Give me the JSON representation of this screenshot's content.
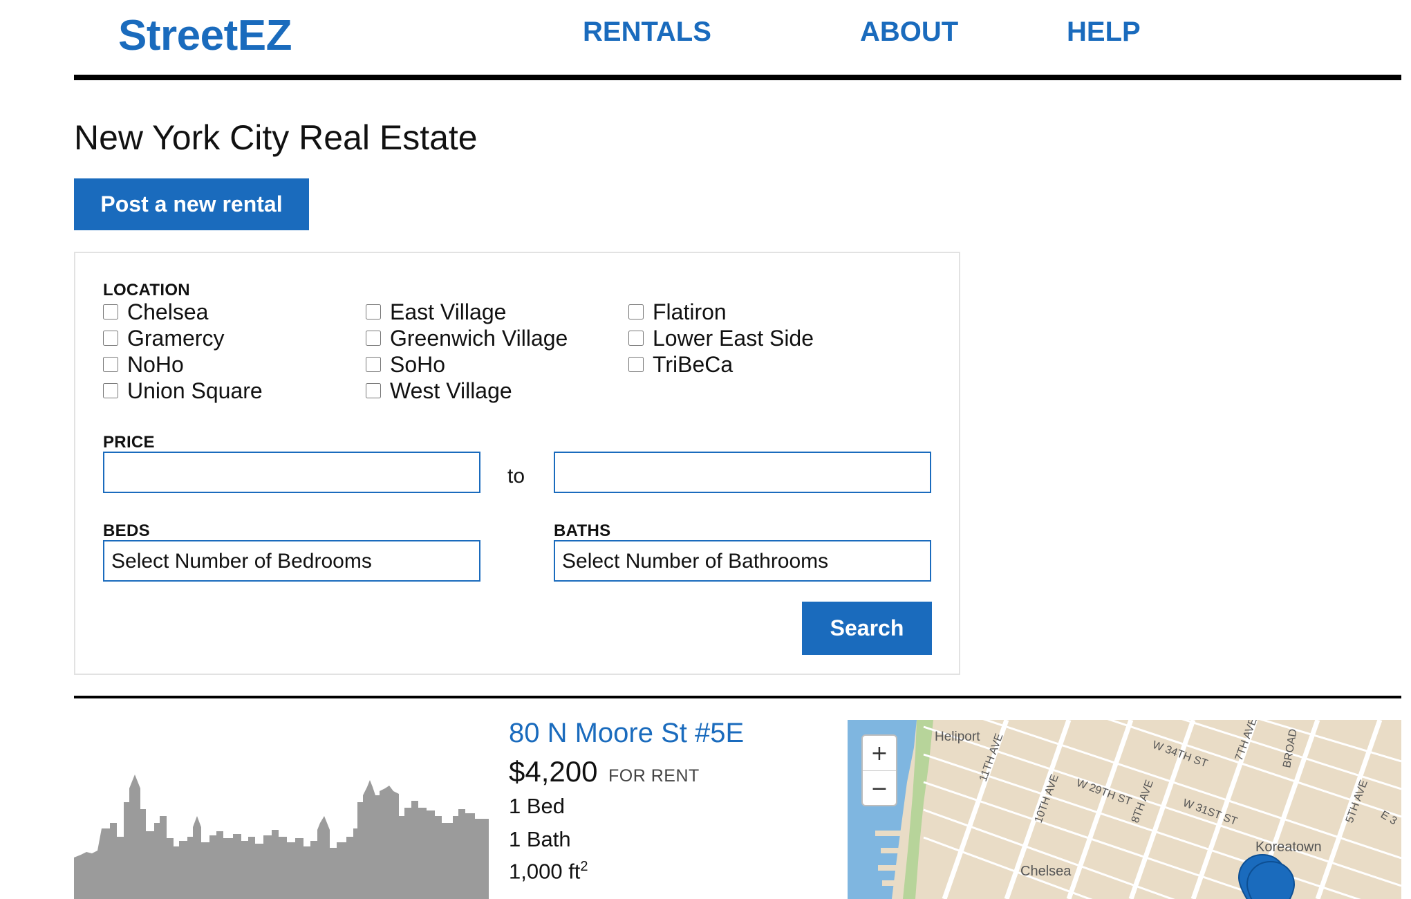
{
  "header": {
    "logo": "StreetEZ",
    "nav": [
      "RENTALS",
      "ABOUT",
      "HELP"
    ]
  },
  "page": {
    "title": "New York City Real Estate",
    "post_button": "Post a new rental"
  },
  "search": {
    "location_label": "LOCATION",
    "locations": [
      "Chelsea",
      "Gramercy",
      "NoHo",
      "Union Square",
      "East Village",
      "Greenwich Village",
      "SoHo",
      "West Village",
      "Flatiron",
      "Lower East Side",
      "TriBeCa"
    ],
    "price_label": "PRICE",
    "price_to": "to",
    "price_min_value": "",
    "price_max_value": "",
    "beds_label": "BEDS",
    "beds_selected": "Select Number of Bedrooms",
    "baths_label": "BATHS",
    "baths_selected": "Select Number of Bathrooms",
    "search_button": "Search"
  },
  "listing": {
    "title": "80 N Moore St #5E",
    "price": "$4,200",
    "status": "FOR RENT",
    "beds": "1 Bed",
    "baths": "1 Bath",
    "area": "1,000 ft",
    "area_unit_sup": "2"
  },
  "map": {
    "zoom_in": "+",
    "zoom_out": "−",
    "labels": [
      "Heliport",
      "11TH AVE",
      "10TH AVE",
      "W 29TH ST",
      "8TH AVE",
      "W 34TH ST",
      "W 31ST ST",
      "7TH AVE",
      "BROAD",
      "5TH AVE",
      "Koreatown",
      "Chelsea",
      "E 3"
    ],
    "colors": {
      "water": "#7fb6e0",
      "land": "#e9dcc6",
      "park": "#b7d49a",
      "road": "#ffffff",
      "marker": "#1a6bbd"
    },
    "marker_icon": "map-pin-icon"
  }
}
